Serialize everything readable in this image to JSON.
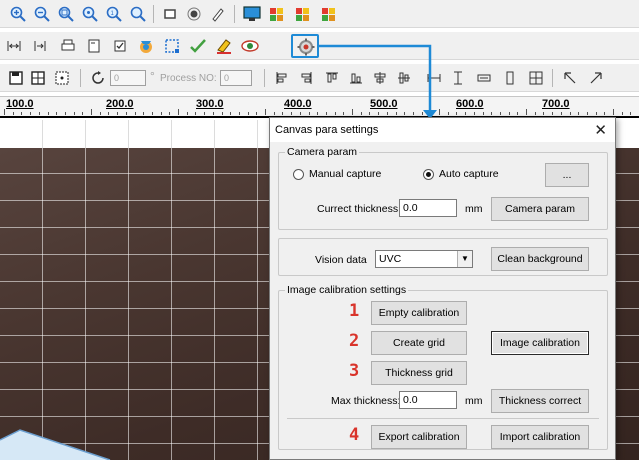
{
  "toolbar_row1": {
    "icons": [
      "zoom-in-icon",
      "zoom-out-icon",
      "zoom-fit-icon",
      "zoom-area-icon",
      "zoom-actual-icon",
      "zoom-window-icon",
      "rectangle-icon",
      "circle-icon",
      "pen-icon",
      "monitor-icon",
      "color-select-icon",
      "color-deselect-icon",
      "color-alt-icon"
    ]
  },
  "toolbar_row2": {
    "icons": [
      "fit-width-icon",
      "fit-height-icon",
      "print-icon",
      "page-icon",
      "checkbox-icon",
      "camera-icon",
      "selection-icon",
      "check-icon",
      "eraser-icon",
      "eye-icon",
      "settings-gear-icon"
    ]
  },
  "toolbar_row3": {
    "spin1_value": "0",
    "degree_symbol": "°",
    "process_label": "Process NO:",
    "process_value": "0",
    "icons": [
      "align-left-icon",
      "align-right-icon",
      "align-top-icon",
      "align-bottom-icon",
      "align-center-h-icon",
      "align-center-v-icon",
      "same-width-icon",
      "same-height-icon",
      "same-size-icon",
      "grid-icon",
      "square-icon",
      "arrow-up-left-icon",
      "arrow-up-right-icon"
    ]
  },
  "ruler": {
    "labels": [
      "100.0",
      "200.0",
      "300.0",
      "400.0",
      "500.0",
      "600.0",
      "700.0"
    ]
  },
  "dialog": {
    "title": "Canvas para settings",
    "close_glyph": "✕",
    "camera_group": {
      "legend": "Camera param",
      "manual_label": "Manual capture",
      "auto_label": "Auto capture",
      "browse_label": "...",
      "thickness_label": "Currect thickness:",
      "thickness_value": "0.0",
      "unit": "mm",
      "camera_param_button": "Camera param"
    },
    "vision_group": {
      "label": "Vision data",
      "selected": "UVC",
      "clean_button": "Clean background"
    },
    "calib_group": {
      "legend": "Image calibration settings",
      "steps": [
        "1",
        "2",
        "3",
        "4"
      ],
      "empty_button": "Empty calibration",
      "create_grid_button": "Create grid",
      "image_calib_button": "Image calibration",
      "thickness_grid_button": "Thickness grid",
      "max_thickness_label": "Max thickness:",
      "max_thickness_value": "0.0",
      "unit": "mm",
      "thickness_correct_button": "Thickness correct",
      "export_button": "Export calibration",
      "import_button": "Import calibration"
    }
  },
  "colors": {
    "accent": "#1e8ad6",
    "step_red": "#d9342b"
  }
}
